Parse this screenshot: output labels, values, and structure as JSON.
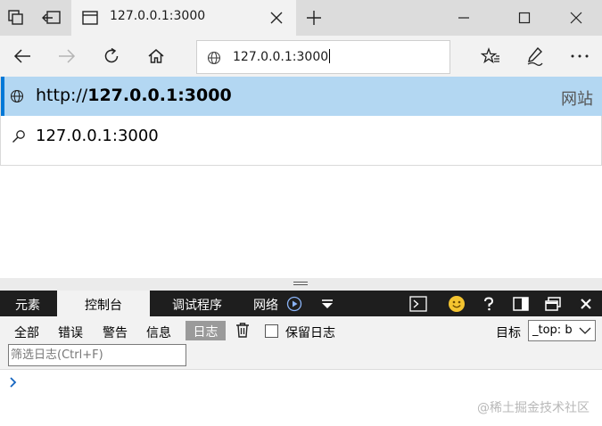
{
  "browser": {
    "tab_title": "127.0.0.1:3000",
    "address_value": "127.0.0.1:3000"
  },
  "suggestions": [
    {
      "prefix": "http://",
      "bold": "127.0.0.1:3000",
      "type": "网站",
      "icon": "globe-icon"
    },
    {
      "text": "127.0.0.1:3000",
      "icon": "search-icon"
    }
  ],
  "devtools": {
    "tabs": [
      {
        "label": "元素"
      },
      {
        "label": "控制台",
        "active": true
      },
      {
        "label": "调试程序"
      },
      {
        "label": "网络"
      }
    ],
    "filters": [
      "全部",
      "错误",
      "警告",
      "信息",
      "日志"
    ],
    "active_filter": "日志",
    "preserve_log_label": "保留日志",
    "target_label": "目标",
    "target_value": "_top: b",
    "filter_placeholder": "筛选日志(Ctrl+F)",
    "prompt_icon": "chevron-right-icon"
  },
  "watermark": "@稀土掘金技术社区",
  "colors": {
    "accent": "#0078d7",
    "suggestion_highlight": "#b3d7f2",
    "devtools_dark": "#1e1e1e",
    "emoji": "#f4c430"
  }
}
